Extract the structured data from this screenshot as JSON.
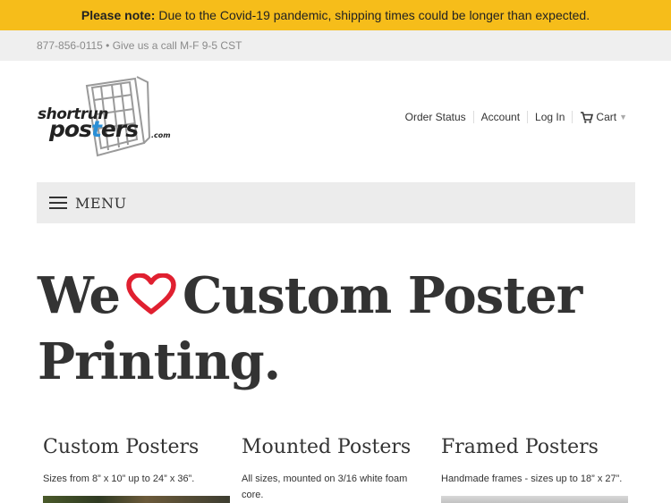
{
  "notice": {
    "strong": "Please note:",
    "text": "Due to the Covid-19 pandemic, shipping times could be longer than expected."
  },
  "topbar": {
    "contact": "877-856-0115 • Give us a call M-F 9-5 CST"
  },
  "logo": {
    "line1": "shortrun",
    "line2_a": "pos",
    "line2_b": "t",
    "line2_c": "ers",
    "suffix": ".com"
  },
  "nav": {
    "items": [
      {
        "label": "Order Status"
      },
      {
        "label": "Account"
      },
      {
        "label": "Log In"
      }
    ],
    "cart_label": "Cart"
  },
  "menu": {
    "label": "MENU"
  },
  "hero": {
    "word1": "We",
    "word2": "Custom Poster",
    "line2": "Printing."
  },
  "products": [
    {
      "title": "Custom Posters",
      "desc": "Sizes from 8” x 10” up to 24” x 36”."
    },
    {
      "title": "Mounted Posters",
      "desc": "All sizes, mounted on 3/16 white foam core."
    },
    {
      "title": "Framed Posters",
      "desc": "Handmade frames - sizes up to 18” x 27”."
    }
  ],
  "colors": {
    "notice_bg": "#f6bd1a",
    "heart": "#e02030",
    "logo_accent": "#2a8fd6"
  }
}
